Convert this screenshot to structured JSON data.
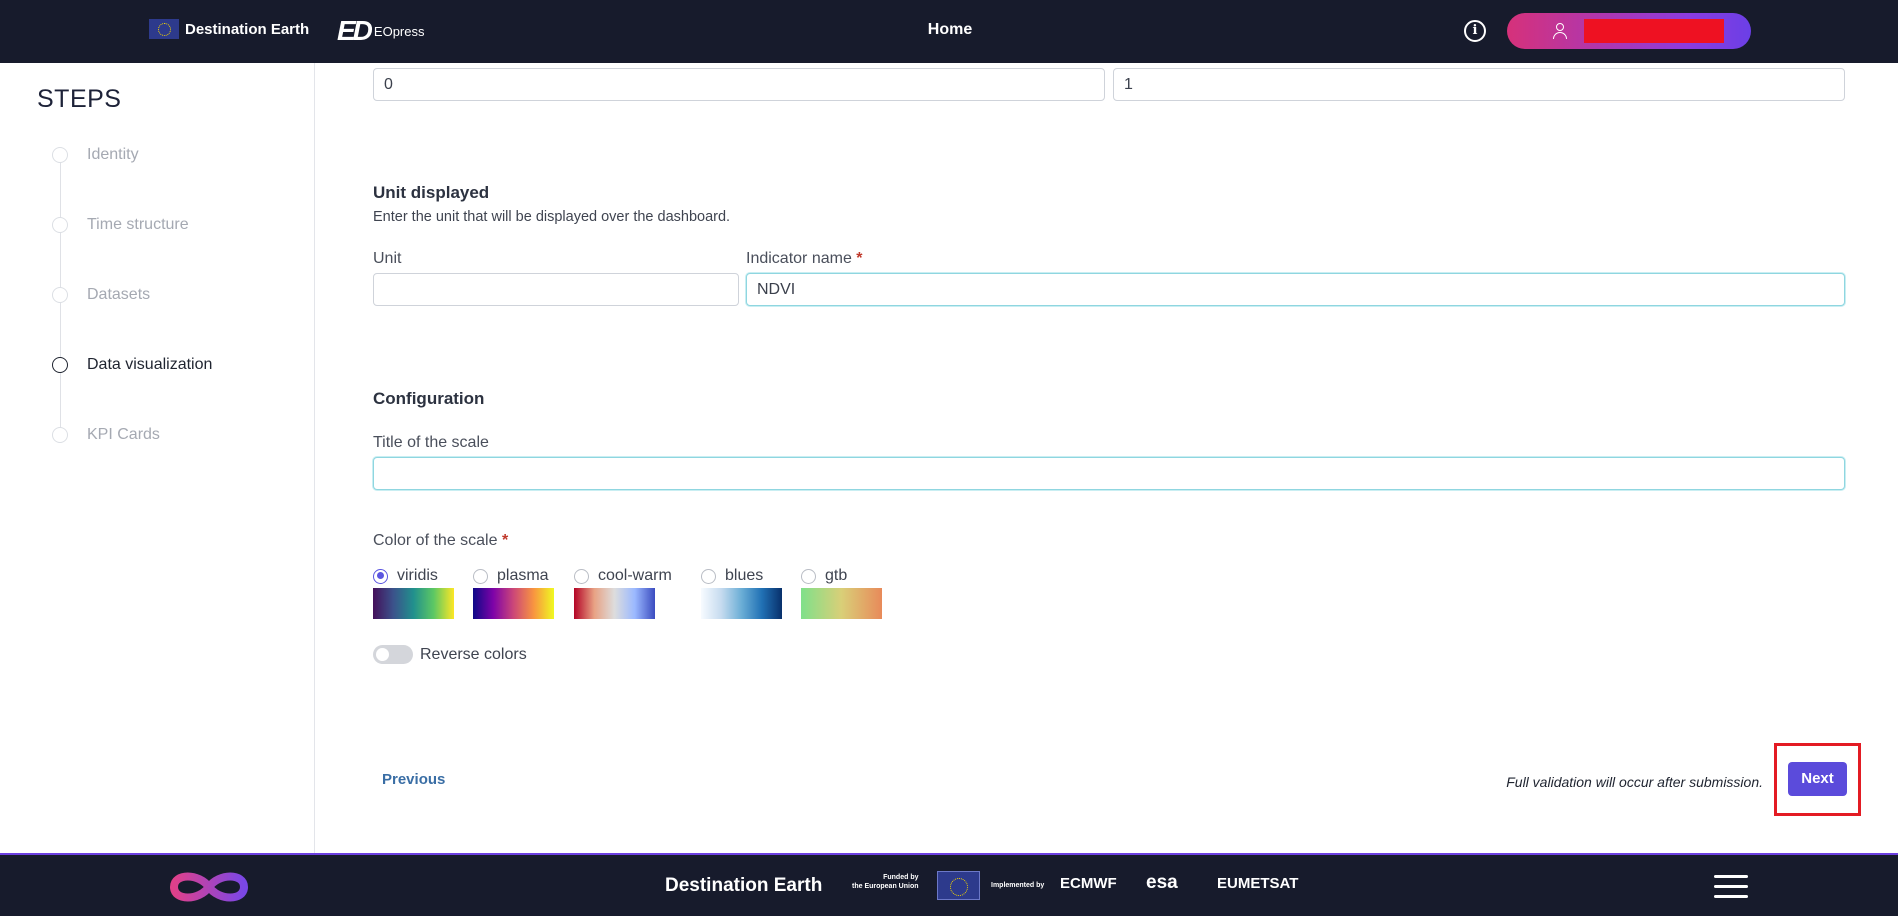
{
  "header": {
    "brand": "Destination Earth",
    "eopress_mark": "ED",
    "eopress_text": "EOpress",
    "page_title": "Home",
    "info_icon": "info-icon",
    "user_icon": "user-icon",
    "user_name": "redacted"
  },
  "sidebar": {
    "title": "STEPS",
    "steps": [
      {
        "label": "Identity",
        "active": false
      },
      {
        "label": "Time structure",
        "active": false
      },
      {
        "label": "Datasets",
        "active": false
      },
      {
        "label": "Data visualization",
        "active": true
      },
      {
        "label": "KPI Cards",
        "active": false
      }
    ]
  },
  "form": {
    "range_min": "0",
    "range_max": "1",
    "unit_section": {
      "title": "Unit displayed",
      "help": "Enter the unit that will be displayed over the dashboard.",
      "unit_label": "Unit",
      "unit_value": "",
      "indicator_label": "Indicator name",
      "indicator_value": "NDVI",
      "required_mark": "*"
    },
    "config_section": {
      "title": "Configuration",
      "scale_title_label": "Title of the scale",
      "scale_title_value": "",
      "color_label": "Color of the scale",
      "required_mark": "*",
      "color_options": [
        {
          "label": "viridis",
          "selected": true
        },
        {
          "label": "plasma",
          "selected": false
        },
        {
          "label": "cool-warm",
          "selected": false
        },
        {
          "label": "blues",
          "selected": false
        },
        {
          "label": "gtb",
          "selected": false
        }
      ],
      "reverse_label": "Reverse colors",
      "reverse_on": false
    },
    "previous_label": "Previous",
    "validation_note": "Full validation will occur after submission.",
    "next_label": "Next"
  },
  "footer": {
    "title": "Destination Earth",
    "funded_line1": "Funded by",
    "funded_line2": "the European Union",
    "implemented": "Implemented by",
    "partners": [
      "ECMWF",
      "esa",
      "EUMETSAT"
    ],
    "logo_icon": "infinity-logo-icon",
    "menu_icon": "hamburger-menu-icon"
  },
  "colors": {
    "header_bg": "#171b2c",
    "accent": "#5b4bdb",
    "highlight": "#e31b23"
  }
}
